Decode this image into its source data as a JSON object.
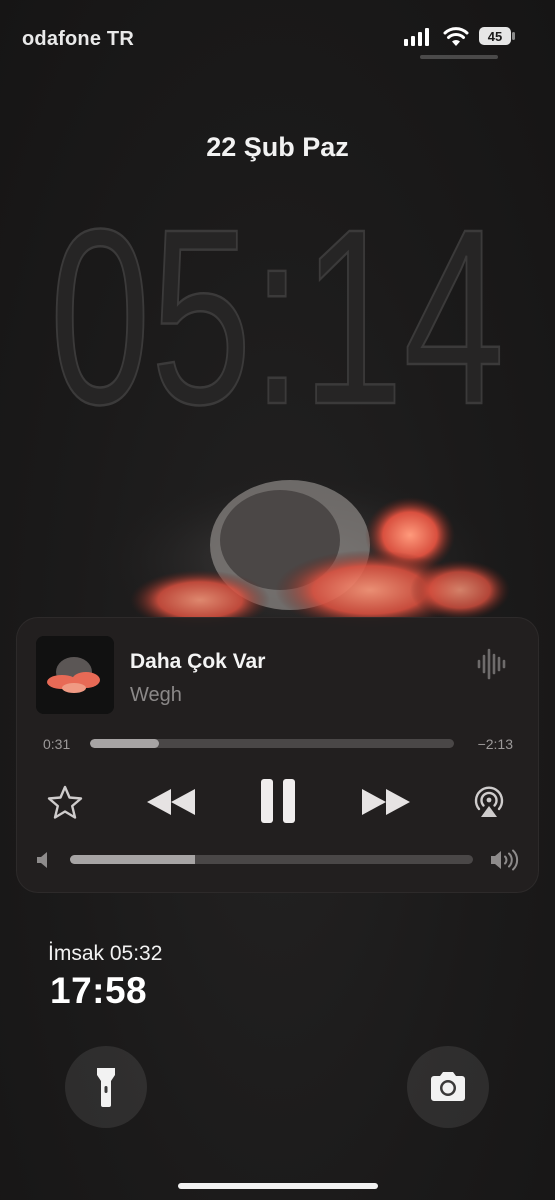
{
  "status_bar": {
    "carrier": "odafone TR",
    "battery": "45"
  },
  "lock_screen": {
    "date": "22 Şub Paz",
    "time": "05:14"
  },
  "now_playing": {
    "title": "Daha Çok Var",
    "artist": "Wegh",
    "elapsed": "0:31",
    "remaining": "−2:13",
    "progress_fraction": 0.19,
    "volume_fraction": 0.31
  },
  "prayer_widget": {
    "next_prayer": "İmsak 05:32",
    "countdown": "17:58"
  },
  "icons": [
    "signal-icon",
    "wifi-icon",
    "battery-icon",
    "waveform-icon",
    "star-icon",
    "rewind-icon",
    "pause-icon",
    "fast-forward-icon",
    "airplay-icon",
    "volume-low-icon",
    "volume-high-icon",
    "flashlight-icon",
    "camera-icon"
  ],
  "colors": {
    "background": "#1b1a1a",
    "player_bg": "#221f1f",
    "progress_fill": "#a7a4a4",
    "art_accent": "#e86a56"
  }
}
